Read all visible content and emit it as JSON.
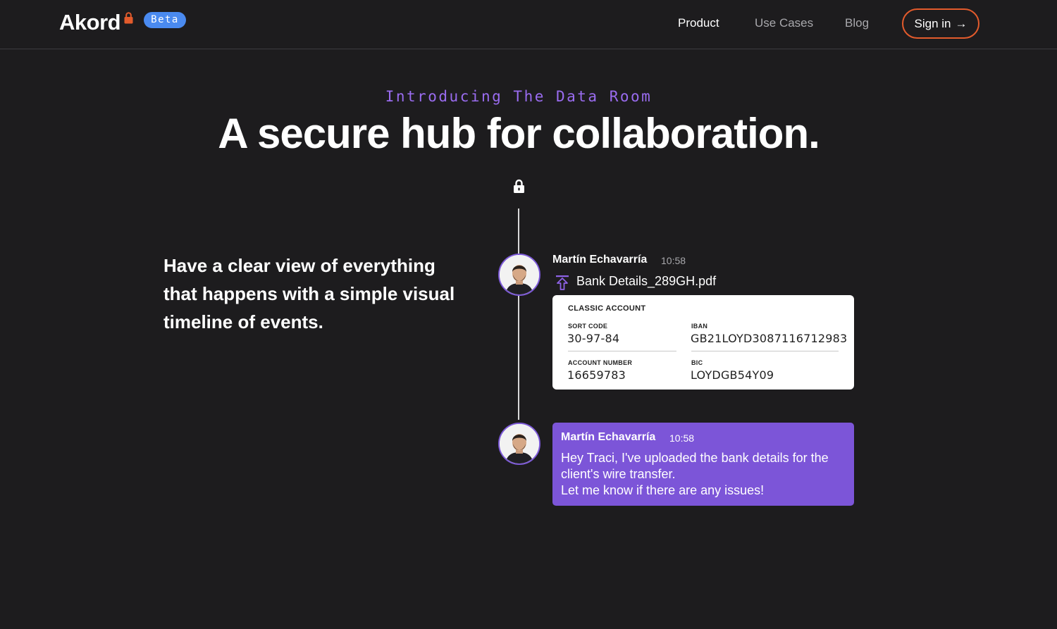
{
  "header": {
    "logo": "Akord",
    "badge": "Beta",
    "nav": [
      "Product",
      "Use Cases",
      "Blog"
    ],
    "signin_label": "Sign in",
    "signin_arrow": "→"
  },
  "hero": {
    "eyebrow": "Introducing The Data Room",
    "headline": "A secure hub for collaboration."
  },
  "feature": {
    "description": "Have a clear view of everything that happens with a simple visual timeline of events."
  },
  "timeline": {
    "upload_event": {
      "user": "Martín Echavarría",
      "time": "10:58",
      "file": "Bank Details_289GH.pdf",
      "card": {
        "title": "CLASSIC ACCOUNT",
        "sort_code_label": "SORT CODE",
        "sort_code": "30-97-84",
        "iban_label": "IBAN",
        "iban": "GB21LOYD3087116712983",
        "account_number_label": "ACCOUNT NUMBER",
        "account_number": "16659783",
        "bic_label": "BIC",
        "bic": "LOYDGB54Y09"
      }
    },
    "message_event": {
      "user": "Martín Echavarría",
      "time": "10:58",
      "line1": "Hey Traci, I've uploaded the bank details for the client's wire transfer.",
      "line2": "Let me know if there are any issues!"
    }
  },
  "colors": {
    "background": "#1d1c1e",
    "accent_purple": "#7c55d8",
    "eyebrow_purple": "#9a6cf0",
    "beta_blue": "#4a8af0",
    "signin_border": "#e35b2c"
  }
}
